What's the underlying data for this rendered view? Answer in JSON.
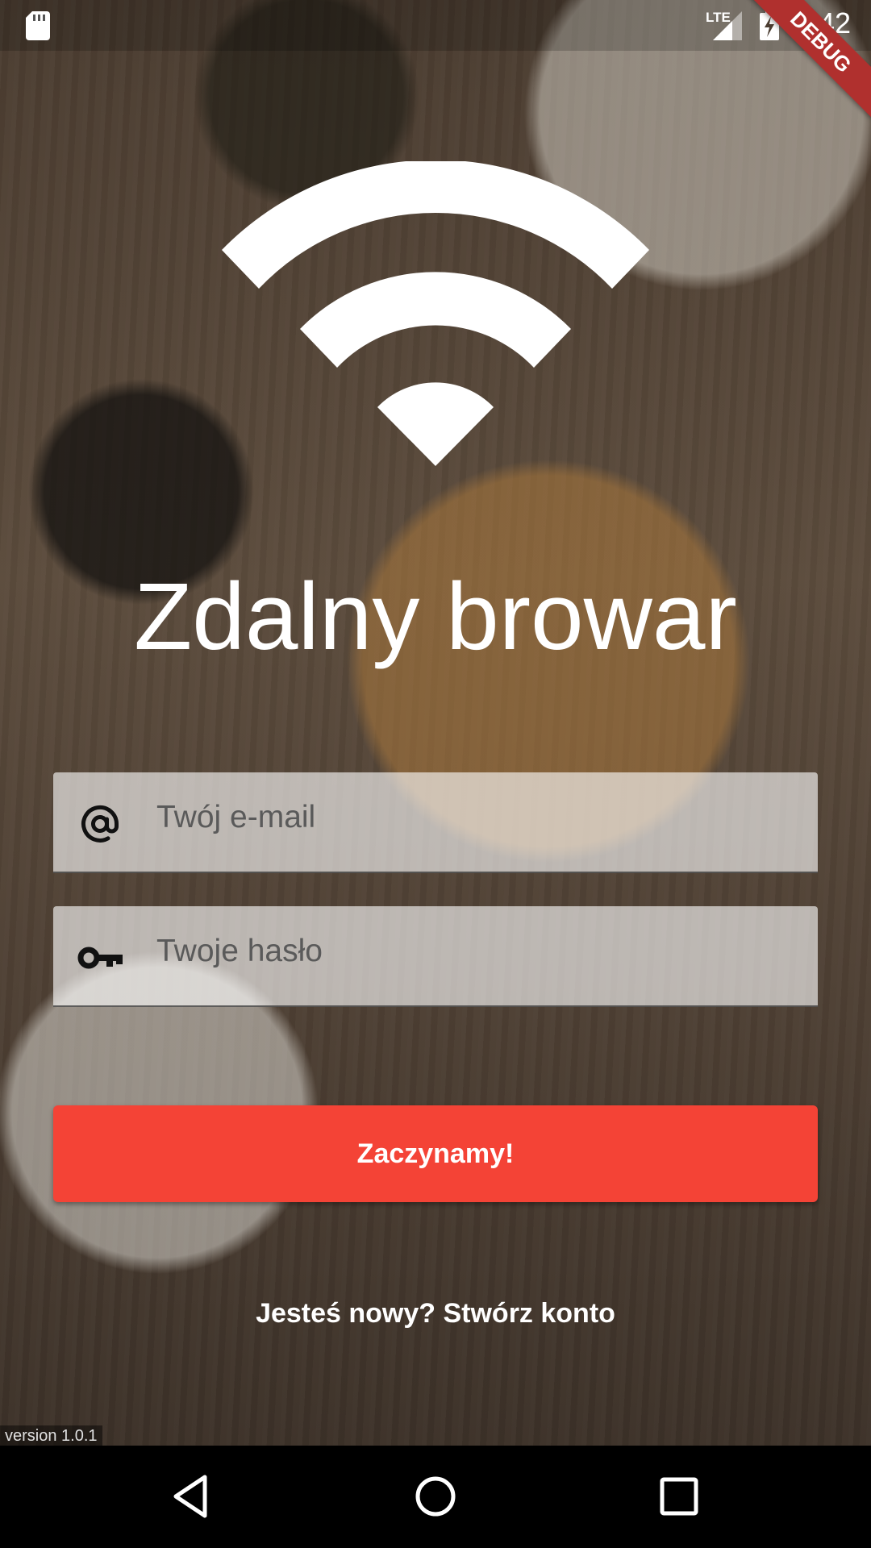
{
  "status_bar": {
    "time": "1:42",
    "network": "LTE",
    "icons": [
      "sd-card-icon",
      "signal-icon",
      "battery-charging-icon"
    ]
  },
  "debug_banner": "DEBUG",
  "logo": {
    "icon": "wifi-icon"
  },
  "title": "Zdalny browar",
  "email_field": {
    "icon": "at-sign-icon",
    "placeholder": "Twój e-mail",
    "value": ""
  },
  "password_field": {
    "icon": "key-icon",
    "placeholder": "Twoje hasło",
    "value": ""
  },
  "start_button": {
    "label": "Zaczynamy!",
    "color": "#f44336"
  },
  "register_link": "Jesteś nowy? Stwórz konto",
  "version": "version 1.0.1",
  "nav_bar": {
    "icons": [
      "back-icon",
      "home-icon",
      "recent-apps-icon"
    ]
  }
}
